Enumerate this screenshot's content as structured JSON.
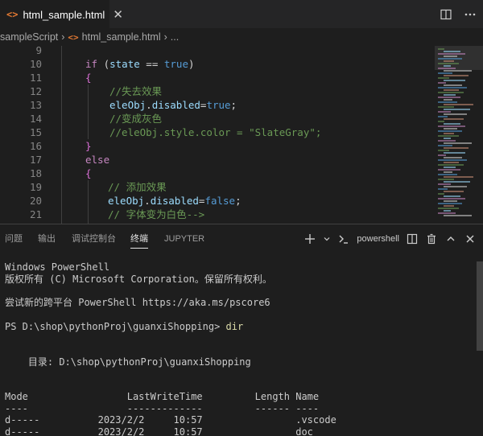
{
  "tab": {
    "title": "html_sample.html",
    "icon": "html-file-icon",
    "close_glyph": "✕"
  },
  "breadcrumb": {
    "folder": "sampleScript",
    "file": "html_sample.html",
    "tail": "..."
  },
  "editor": {
    "line_numbers": [
      "9",
      "10",
      "11",
      "12",
      "13",
      "14",
      "15",
      "16",
      "17",
      "18",
      "19",
      "20",
      "21"
    ],
    "colors": {
      "keyword": "#c586c0",
      "variable": "#9cdcfe",
      "boolean": "#569cd6",
      "comment": "#6a9955",
      "string": "#ce9178",
      "brace": "#da70d6",
      "text": "#d4d4d4"
    }
  },
  "code": {
    "l10": {
      "kw": "if",
      "p1": " (",
      "var": "state",
      "op": " == ",
      "bool": "true",
      "p2": ")"
    },
    "l11": "{",
    "l12": "//失去效果",
    "l13": {
      "obj": "eleObj",
      "dot": ".",
      "prop": "disabled",
      "eq": "=",
      "val": "true",
      "end": ";"
    },
    "l14": "//变成灰色",
    "l15": "//eleObj.style.color = \"SlateGray\";",
    "l16": "}",
    "l17": "else",
    "l18": "{",
    "l19": "// 添加效果",
    "l20": {
      "obj": "eleObj",
      "dot": ".",
      "prop": "disabled",
      "eq": "=",
      "val": "false",
      "end": ";"
    },
    "l21": "// 字体变为白色-->"
  },
  "panel": {
    "tabs": [
      "问题",
      "输出",
      "调试控制台",
      "终端",
      "JUPYTER"
    ],
    "active_tab": "终端",
    "shell_label": "powershell"
  },
  "terminal": {
    "lines": [
      "Windows PowerShell",
      "版权所有 (C) Microsoft Corporation。保留所有权利。",
      "尝试新的跨平台 PowerShell https://aka.ms/pscore6",
      "PS D:\\shop\\pythonProj\\guanxiShopping>",
      "dir",
      "    目录: D:\\shop\\pythonProj\\guanxiShopping",
      "Mode                 LastWriteTime         Length Name",
      "----                 -------------         ------ ----",
      "d-----          2023/2/2     10:57                .vscode",
      "d-----          2023/2/2     10:57                doc"
    ]
  }
}
